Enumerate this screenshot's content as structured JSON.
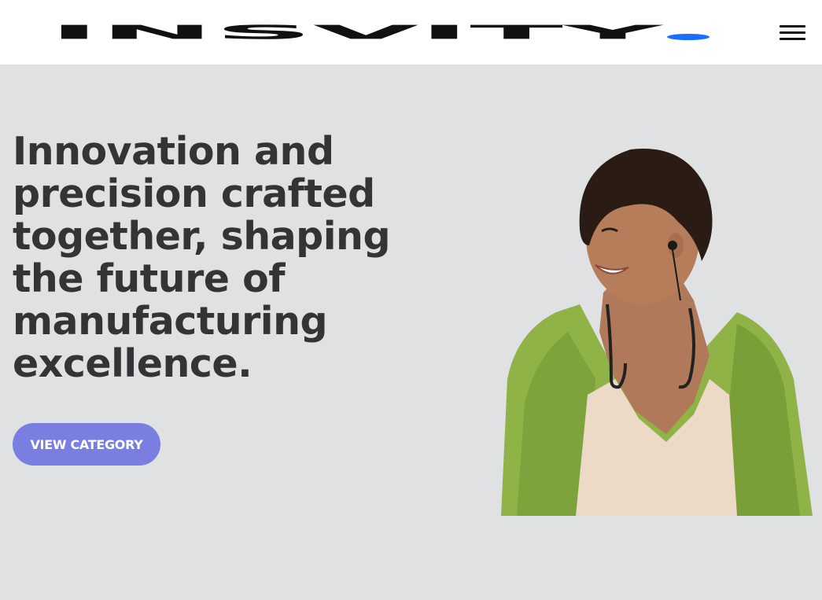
{
  "header": {
    "logo_text": "INSVITY",
    "logo_dot_color": "#1a6dff",
    "menu_icon": "hamburger-menu-icon"
  },
  "hero": {
    "headline": "Innovation and precision crafted together, shaping the future of manufacturing excellence.",
    "cta_label": "VIEW CATEGORY",
    "cta_color": "#7a7ee0",
    "background_color": "#dfe1e3",
    "image_subject": "woman-with-neckband-earphones"
  }
}
